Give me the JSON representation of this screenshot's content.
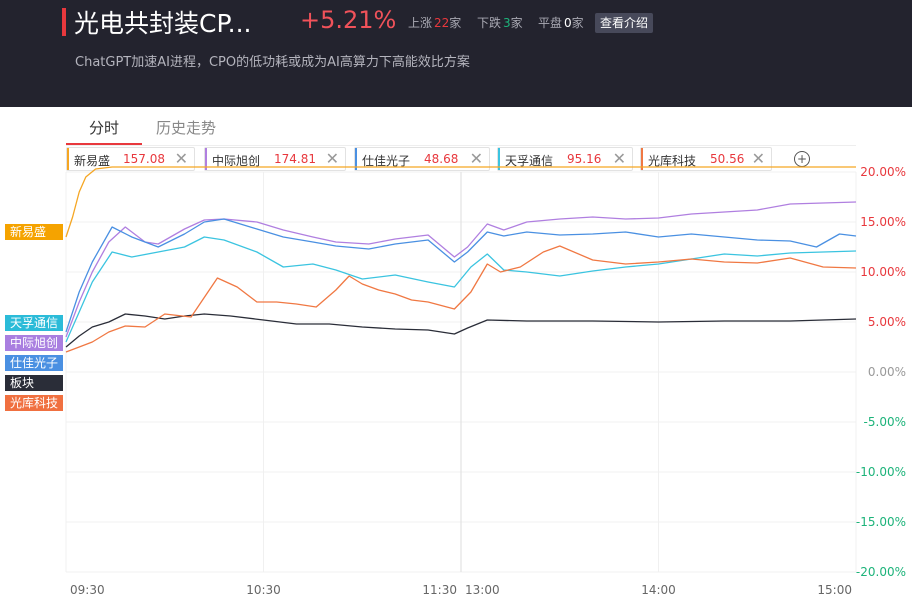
{
  "header": {
    "title": "光电共封装CP...",
    "change_pct": "+5.21%",
    "up_label": "上涨",
    "up_count": "22",
    "up_unit": "家",
    "down_label": "下跌",
    "down_count": "3",
    "down_unit": "家",
    "flat_label": "平盘",
    "flat_count": "0",
    "flat_unit": "家",
    "intro_button": "查看介绍",
    "subtitle": "ChatGPT加速AI进程，CPO的低功耗或成为AI高算力下高能效比方案",
    "accent": "#e8383d"
  },
  "tabs": [
    {
      "label": "分时",
      "active": true
    },
    {
      "label": "历史走势",
      "active": false
    }
  ],
  "compare_chips": [
    {
      "name": "新易盛",
      "value": "157.08",
      "color": "#f5a623",
      "close_icon": "close-icon"
    },
    {
      "name": "中际旭创",
      "value": "174.81",
      "color": "#b07fe0",
      "close_icon": "close-icon"
    },
    {
      "name": "仕佳光子",
      "value": "48.68",
      "color": "#4a90e2",
      "close_icon": "close-icon"
    },
    {
      "name": "天孚通信",
      "value": "95.16",
      "color": "#3bc4e0",
      "close_icon": "close-icon"
    },
    {
      "name": "光库科技",
      "value": "50.56",
      "color": "#f07843",
      "close_icon": "close-icon"
    }
  ],
  "add_icon": "plus-circle-icon",
  "series_tags": [
    {
      "label": "新易盛",
      "color": "#f5a300"
    },
    {
      "label": "天孚通信",
      "color": "#2bbbd8"
    },
    {
      "label": "中际旭创",
      "color": "#a97fe0"
    },
    {
      "label": "仕佳光子",
      "color": "#4a90e2"
    },
    {
      "label": "板块",
      "color": "#2a2d38"
    },
    {
      "label": "光库科技",
      "color": "#f07040"
    }
  ],
  "chart_data": {
    "type": "line",
    "x_ticks": [
      "09:30",
      "10:30",
      "11:30",
      "13:00",
      "14:00",
      "15:00"
    ],
    "y_ticks": [
      "20.00%",
      "15.00%",
      "10.00%",
      "5.00%",
      "0.00%",
      "-5.00%",
      "-10.00%",
      "-15.00%",
      "-20.00%"
    ],
    "ylim": [
      -20,
      20
    ],
    "y_unit": "%",
    "grid": true,
    "series": [
      {
        "name": "新易盛",
        "color": "#f5a623",
        "points": [
          [
            0,
            13.5
          ],
          [
            2,
            15.5
          ],
          [
            4,
            18
          ],
          [
            6,
            19.5
          ],
          [
            9,
            20.3
          ],
          [
            14,
            20.5
          ],
          [
            30,
            20.5
          ],
          [
            60,
            20.5
          ],
          [
            120,
            20.5
          ],
          [
            180,
            20.5
          ],
          [
            240,
            20.5
          ]
        ]
      },
      {
        "name": "中际旭创",
        "color": "#b07fe0",
        "points": [
          [
            0,
            3.5
          ],
          [
            4,
            7
          ],
          [
            8,
            10
          ],
          [
            13,
            13
          ],
          [
            18,
            14.5
          ],
          [
            24,
            13
          ],
          [
            28,
            12.8
          ],
          [
            36,
            14.3
          ],
          [
            42,
            15.2
          ],
          [
            48,
            15.3
          ],
          [
            58,
            15
          ],
          [
            66,
            14.2
          ],
          [
            75,
            13.5
          ],
          [
            82,
            13
          ],
          [
            92,
            12.8
          ],
          [
            100,
            13.3
          ],
          [
            110,
            13.7
          ],
          [
            118,
            11.5
          ],
          [
            122,
            12.5
          ],
          [
            128,
            14.8
          ],
          [
            133,
            14.2
          ],
          [
            140,
            15
          ],
          [
            150,
            15.3
          ],
          [
            160,
            15.5
          ],
          [
            170,
            15.3
          ],
          [
            180,
            15.4
          ],
          [
            190,
            15.8
          ],
          [
            200,
            16
          ],
          [
            210,
            16.2
          ],
          [
            220,
            16.8
          ],
          [
            230,
            16.9
          ],
          [
            240,
            17
          ]
        ]
      },
      {
        "name": "仕佳光子",
        "color": "#4a90e2",
        "points": [
          [
            0,
            4
          ],
          [
            4,
            8
          ],
          [
            8,
            11
          ],
          [
            14,
            14.5
          ],
          [
            20,
            13.5
          ],
          [
            28,
            12.5
          ],
          [
            36,
            13.8
          ],
          [
            42,
            15
          ],
          [
            48,
            15.3
          ],
          [
            58,
            14.3
          ],
          [
            66,
            13.5
          ],
          [
            75,
            13
          ],
          [
            82,
            12.6
          ],
          [
            92,
            12.3
          ],
          [
            100,
            12.8
          ],
          [
            110,
            13.2
          ],
          [
            118,
            11
          ],
          [
            122,
            12
          ],
          [
            128,
            14
          ],
          [
            133,
            13.6
          ],
          [
            140,
            14
          ],
          [
            150,
            13.7
          ],
          [
            160,
            13.8
          ],
          [
            170,
            14
          ],
          [
            180,
            13.5
          ],
          [
            190,
            13.8
          ],
          [
            200,
            13.5
          ],
          [
            210,
            13.2
          ],
          [
            220,
            13.1
          ],
          [
            228,
            12.5
          ],
          [
            235,
            13.8
          ],
          [
            240,
            13.6
          ]
        ]
      },
      {
        "name": "天孚通信",
        "color": "#3bc4e0",
        "points": [
          [
            0,
            3
          ],
          [
            4,
            6
          ],
          [
            8,
            9
          ],
          [
            14,
            12
          ],
          [
            20,
            11.5
          ],
          [
            28,
            12
          ],
          [
            36,
            12.5
          ],
          [
            42,
            13.5
          ],
          [
            48,
            13.2
          ],
          [
            58,
            12
          ],
          [
            66,
            10.5
          ],
          [
            75,
            10.8
          ],
          [
            82,
            10.2
          ],
          [
            90,
            9.3
          ],
          [
            100,
            9.7
          ],
          [
            110,
            9
          ],
          [
            118,
            8.5
          ],
          [
            123,
            10.5
          ],
          [
            128,
            11.8
          ],
          [
            133,
            10.2
          ],
          [
            140,
            10
          ],
          [
            150,
            9.6
          ],
          [
            160,
            10.1
          ],
          [
            170,
            10.5
          ],
          [
            180,
            10.8
          ],
          [
            190,
            11.3
          ],
          [
            200,
            11.8
          ],
          [
            210,
            11.6
          ],
          [
            220,
            11.9
          ],
          [
            230,
            12
          ],
          [
            240,
            12.1
          ]
        ]
      },
      {
        "name": "板块",
        "color": "#2a2d38",
        "points": [
          [
            0,
            2.5
          ],
          [
            4,
            3.6
          ],
          [
            8,
            4.5
          ],
          [
            13,
            5
          ],
          [
            18,
            5.8
          ],
          [
            24,
            5.6
          ],
          [
            30,
            5.3
          ],
          [
            36,
            5.6
          ],
          [
            42,
            5.8
          ],
          [
            50,
            5.6
          ],
          [
            60,
            5.2
          ],
          [
            70,
            4.8
          ],
          [
            80,
            4.8
          ],
          [
            90,
            4.5
          ],
          [
            100,
            4.3
          ],
          [
            110,
            4.2
          ],
          [
            118,
            3.8
          ],
          [
            122,
            4.4
          ],
          [
            128,
            5.2
          ],
          [
            140,
            5.1
          ],
          [
            160,
            5.1
          ],
          [
            180,
            5
          ],
          [
            200,
            5.1
          ],
          [
            220,
            5.1
          ],
          [
            240,
            5.3
          ]
        ]
      },
      {
        "name": "光库科技",
        "color": "#f07843",
        "points": [
          [
            0,
            2
          ],
          [
            4,
            2.5
          ],
          [
            8,
            3
          ],
          [
            13,
            4
          ],
          [
            18,
            4.6
          ],
          [
            24,
            4.5
          ],
          [
            30,
            5.8
          ],
          [
            38,
            5.5
          ],
          [
            46,
            9.4
          ],
          [
            52,
            8.5
          ],
          [
            58,
            7
          ],
          [
            64,
            7
          ],
          [
            70,
            6.8
          ],
          [
            76,
            6.5
          ],
          [
            82,
            8.2
          ],
          [
            86,
            9.6
          ],
          [
            90,
            8.8
          ],
          [
            95,
            8.2
          ],
          [
            100,
            7.8
          ],
          [
            105,
            7.2
          ],
          [
            110,
            7
          ],
          [
            118,
            6.3
          ],
          [
            123,
            8
          ],
          [
            128,
            10.8
          ],
          [
            132,
            10
          ],
          [
            138,
            10.5
          ],
          [
            145,
            12
          ],
          [
            150,
            12.6
          ],
          [
            160,
            11.2
          ],
          [
            170,
            10.8
          ],
          [
            180,
            11
          ],
          [
            190,
            11.3
          ],
          [
            200,
            11
          ],
          [
            210,
            10.9
          ],
          [
            220,
            11.4
          ],
          [
            230,
            10.5
          ],
          [
            240,
            10.4
          ]
        ]
      }
    ]
  }
}
